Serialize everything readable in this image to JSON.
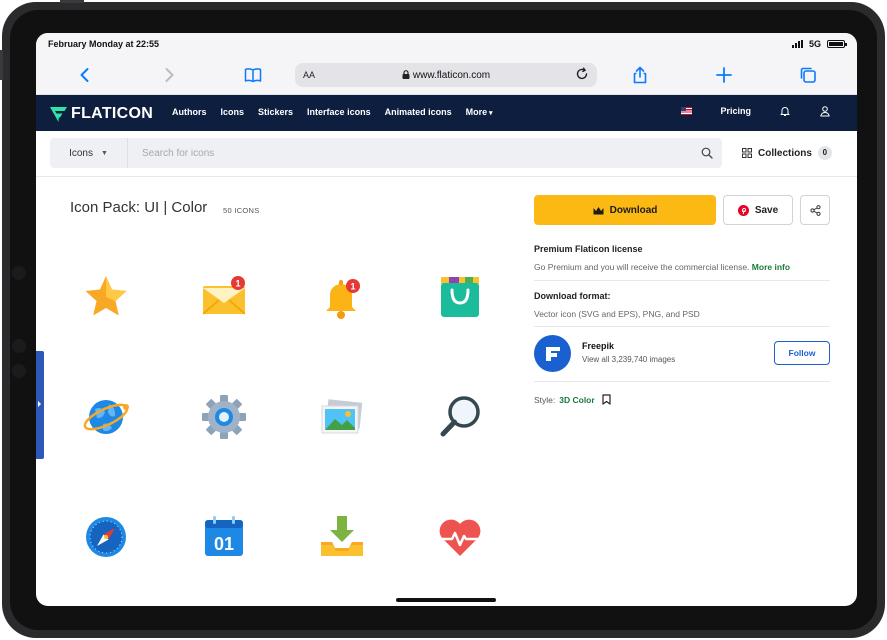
{
  "status_bar": {
    "datetime": "February Monday at 22:55",
    "network": "5G"
  },
  "browser": {
    "text_size_label": "AA",
    "url": "www.flaticon.com"
  },
  "nav": {
    "logo_text": "FLATICON",
    "links": [
      "Authors",
      "Icons",
      "Stickers",
      "Interface icons",
      "Animated icons",
      "More"
    ],
    "pricing": "Pricing"
  },
  "search": {
    "category": "Icons",
    "placeholder": "Search for icons",
    "collections_label": "Collections",
    "collections_count": "0"
  },
  "pack": {
    "title": "Icon Pack: UI | Color",
    "count": "50 ICONS",
    "icons": [
      "star-icon",
      "mail-notification-icon",
      "bell-notification-icon",
      "shopping-bag-icon",
      "globe-icon",
      "gear-icon",
      "gallery-icon",
      "magnifier-icon",
      "compass-icon",
      "calendar-icon",
      "download-tray-icon",
      "heartbeat-icon"
    ],
    "calendar_day": "01",
    "badge_count": "1"
  },
  "sidebar": {
    "download_label": "Download",
    "save_label": "Save",
    "license_title": "Premium Flaticon license",
    "license_text": "Go Premium and you will receive the commercial license.",
    "license_link": "More info",
    "format_title": "Download format:",
    "format_text": "Vector icon (SVG and EPS), PNG, and PSD",
    "author_name": "Freepik",
    "author_sub": "View all 3,239,740 images",
    "follow_label": "Follow",
    "style_label": "Style:",
    "style_value": "3D Color"
  },
  "colors": {
    "nav_bg": "#0e1e3e",
    "download_btn": "#fdb913",
    "ios_blue": "#0a7aff",
    "link_green": "#1b7a3c",
    "freepik_blue": "#1b60d1"
  }
}
